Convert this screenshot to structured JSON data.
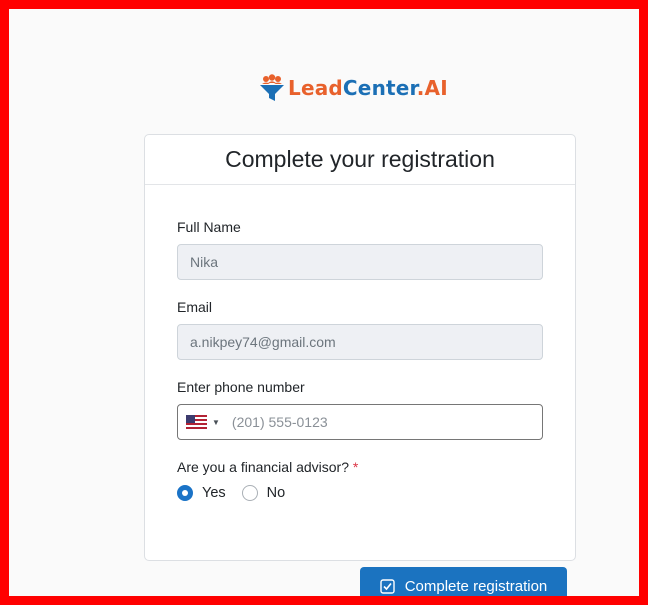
{
  "brand": {
    "lead": "Lead",
    "center": "Center",
    "ai": ".AI",
    "logo_icon": "funnel-people-icon"
  },
  "card": {
    "title": "Complete your registration"
  },
  "form": {
    "full_name": {
      "label": "Full Name",
      "value": "Nika"
    },
    "email": {
      "label": "Email",
      "value": "a.nikpey74@gmail.com"
    },
    "phone": {
      "label": "Enter phone number",
      "placeholder": "(201) 555-0123",
      "country_icon": "us-flag-icon"
    },
    "financial_advisor": {
      "label": "Are you a financial advisor?",
      "required_mark": "*",
      "options": [
        {
          "label": "Yes",
          "selected": true
        },
        {
          "label": "No",
          "selected": false
        }
      ]
    }
  },
  "submit": {
    "label": "Complete registration",
    "icon": "check-square-icon"
  },
  "colors": {
    "frame": "#ff0000",
    "brand_orange": "#e8612c",
    "brand_blue": "#1b6fb5",
    "primary": "#1b73c0"
  }
}
